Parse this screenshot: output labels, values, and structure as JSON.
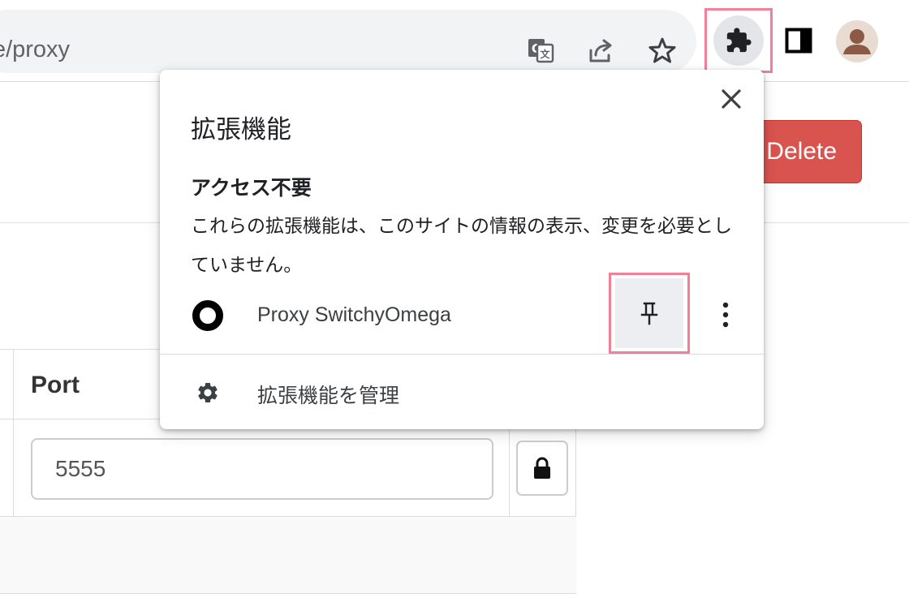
{
  "toolbar": {
    "url": "file/proxy",
    "icons": [
      "translate-icon",
      "share-icon",
      "bookmark-star-icon",
      "extensions-puzzle-icon",
      "side-panel-icon",
      "profile-avatar-icon"
    ]
  },
  "page": {
    "delete_label": "Delete",
    "port_header": "Port",
    "port_value": "5555",
    "lock_icon": "lock-icon"
  },
  "popup": {
    "title": "拡張機能",
    "section_heading": "アクセス不要",
    "section_description": "これらの拡張機能は、このサイトの情報の表示、変更を必要としていません。",
    "extension": {
      "name": "Proxy SwitchyOmega",
      "icon": "switchyomega-ring-icon"
    },
    "manage_label": "拡張機能を管理"
  },
  "colors": {
    "highlight_border": "#ef8096",
    "delete_button": "#d9534f",
    "omnibox_bg": "#f1f3f4"
  }
}
